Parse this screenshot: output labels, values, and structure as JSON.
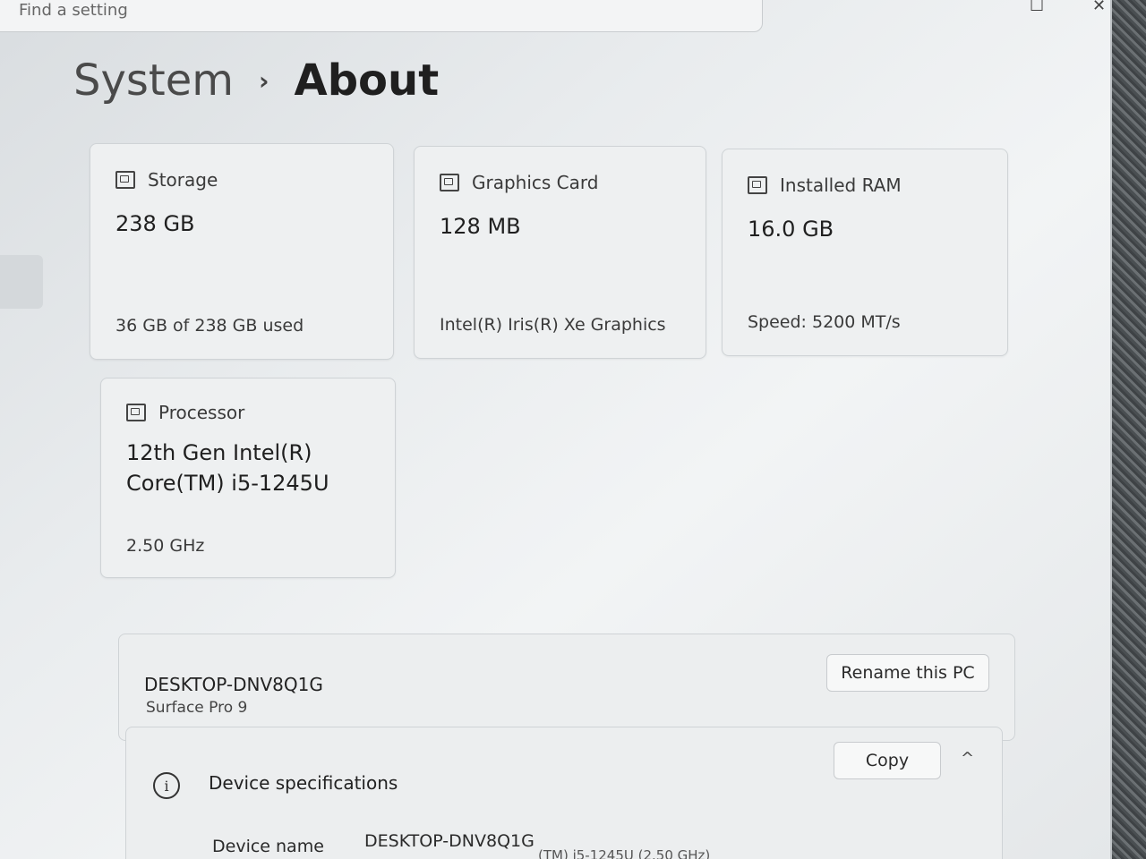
{
  "search": {
    "placeholder": "Find a setting"
  },
  "window": {
    "maximize_glyph": "☐",
    "close_glyph": "✕"
  },
  "breadcrumb": {
    "parent": "System",
    "separator": "›",
    "current": "About"
  },
  "cards": [
    {
      "icon": "storage-icon",
      "label": "Storage",
      "value": "238 GB",
      "detail": "36 GB of 238 GB used"
    },
    {
      "icon": "graphics-card-icon",
      "label": "Graphics Card",
      "value": "128 MB",
      "detail": "Intel(R) Iris(R) Xe Graphics"
    },
    {
      "icon": "ram-icon",
      "label": "Installed RAM",
      "value": "16.0 GB",
      "detail": "Speed: 5200 MT/s"
    },
    {
      "icon": "processor-icon",
      "label": "Processor",
      "value_line1": "12th Gen Intel(R)",
      "value_line2": "Core(TM) i5-1245U",
      "detail": "2.50 GHz"
    }
  ],
  "device": {
    "name": "DESKTOP-DNV8Q1G",
    "model": "Surface Pro 9",
    "rename_label": "Rename this PC"
  },
  "specs": {
    "title": "Device specifications",
    "copy_label": "Copy",
    "collapse_glyph": "^",
    "rows": [
      {
        "label": "Device name",
        "value": "DESKTOP-DNV8Q1G"
      }
    ],
    "partial_processor_text": "(TM) i5-1245U (2.50 GHz)"
  }
}
